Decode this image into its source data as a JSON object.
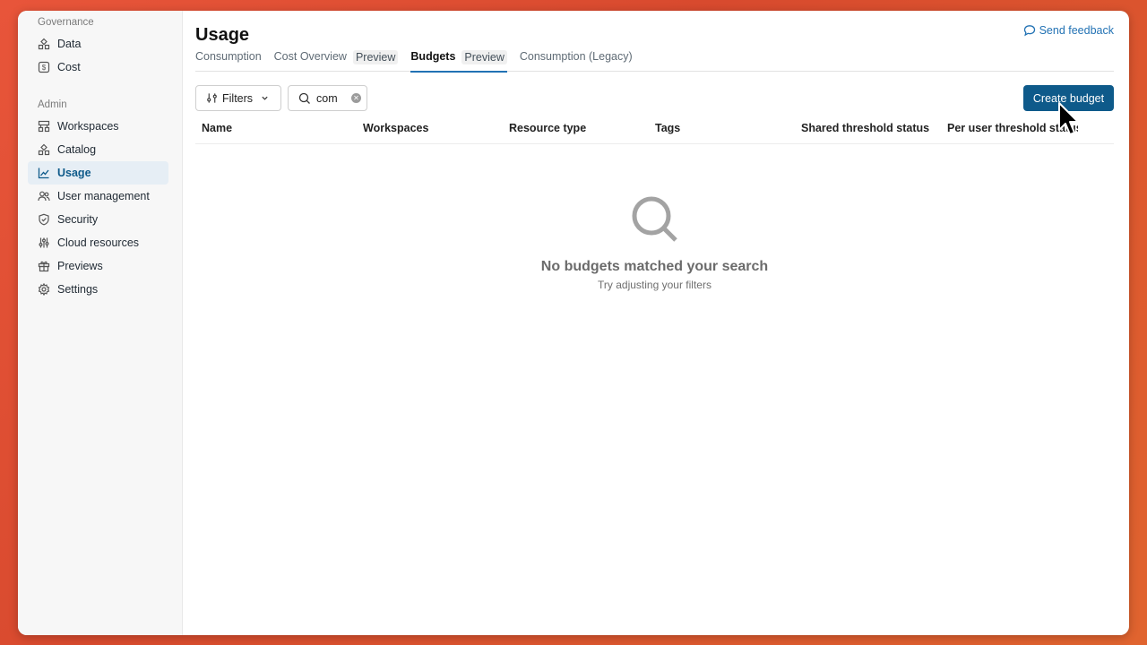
{
  "sidebar": {
    "governance_label": "Governance",
    "admin_label": "Admin",
    "governance_items": [
      {
        "label": "Data",
        "icon": "data-icon"
      },
      {
        "label": "Cost",
        "icon": "cost-icon"
      }
    ],
    "admin_items": [
      {
        "label": "Workspaces",
        "icon": "workspaces-icon"
      },
      {
        "label": "Catalog",
        "icon": "catalog-icon"
      },
      {
        "label": "Usage",
        "icon": "usage-chart-icon",
        "active": true
      },
      {
        "label": "User management",
        "icon": "users-icon"
      },
      {
        "label": "Security",
        "icon": "shield-icon"
      },
      {
        "label": "Cloud resources",
        "icon": "sliders-icon"
      },
      {
        "label": "Previews",
        "icon": "gift-icon"
      },
      {
        "label": "Settings",
        "icon": "gear-icon"
      }
    ]
  },
  "header": {
    "title": "Usage",
    "feedback_label": "Send feedback"
  },
  "tabs": [
    {
      "label": "Consumption",
      "tag": ""
    },
    {
      "label": "Cost Overview",
      "tag": "Preview"
    },
    {
      "label": "Budgets",
      "tag": "Preview",
      "active": true
    },
    {
      "label": "Consumption (Legacy)",
      "tag": ""
    }
  ],
  "toolbar": {
    "filters_label": "Filters",
    "search_value": "com",
    "create_label": "Create budget"
  },
  "table": {
    "columns": [
      "Name",
      "Workspaces",
      "Resource type",
      "Tags",
      "Shared threshold status",
      "Per user threshold status"
    ]
  },
  "empty_state": {
    "title": "No budgets matched your search",
    "subtitle": "Try adjusting your filters"
  },
  "colors": {
    "accent": "#2272b4",
    "primary_button": "#0e5a8a",
    "active_nav_bg": "#e6eef5"
  }
}
